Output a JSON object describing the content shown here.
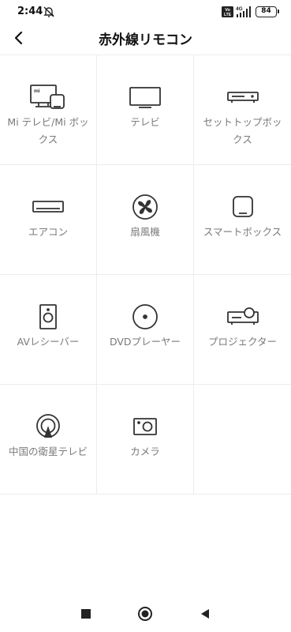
{
  "status_bar": {
    "time": "2:44",
    "network_type": "4G",
    "volte": "Vo LTE",
    "battery": "84",
    "icons": [
      "mute-icon",
      "volte-icon",
      "signal-icon",
      "battery-icon"
    ]
  },
  "header": {
    "title": "赤外線リモコン",
    "back_icon": "chevron-left-icon"
  },
  "devices": [
    {
      "label": "Mi テレビ/Mi ボックス",
      "icon": "mi-tv-box-icon"
    },
    {
      "label": "テレビ",
      "icon": "tv-icon"
    },
    {
      "label": "セットトップボックス",
      "icon": "set-top-box-icon"
    },
    {
      "label": "エアコン",
      "icon": "air-conditioner-icon"
    },
    {
      "label": "扇風機",
      "icon": "fan-icon"
    },
    {
      "label": "スマートボックス",
      "icon": "smart-box-icon"
    },
    {
      "label": "AVレシーバー",
      "icon": "speaker-icon"
    },
    {
      "label": "DVDプレーヤー",
      "icon": "dvd-icon"
    },
    {
      "label": "プロジェクター",
      "icon": "projector-icon"
    },
    {
      "label": "中国の衛星テレビ",
      "icon": "satellite-tv-icon"
    },
    {
      "label": "カメラ",
      "icon": "camera-icon"
    }
  ],
  "nav_bar": {
    "icons": [
      "recents-square-icon",
      "home-circle-icon",
      "back-triangle-icon"
    ]
  }
}
